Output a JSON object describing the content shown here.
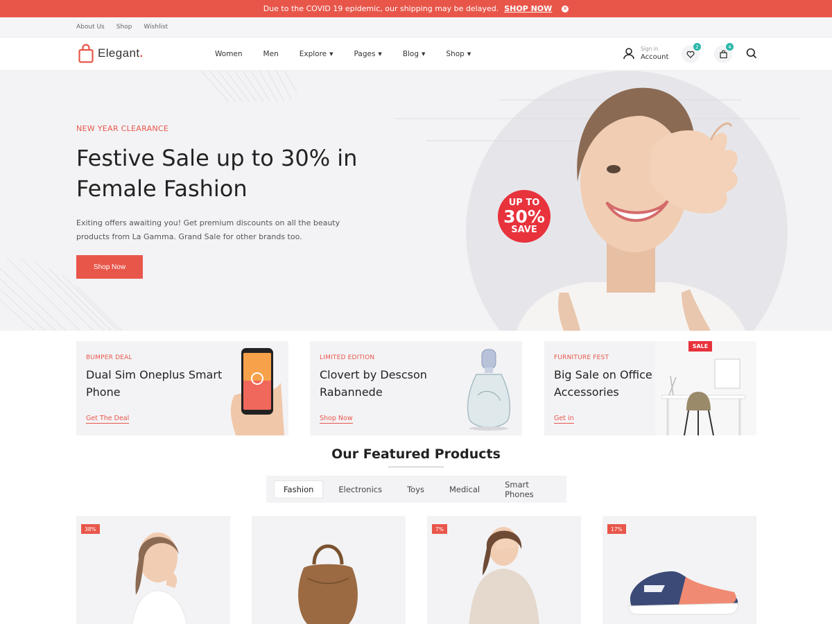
{
  "promo_bar": {
    "text": "Due to the COVID 19 epidemic, our shipping may be delayed.",
    "link": "SHOP NOW",
    "close_icon": "close-icon"
  },
  "util_nav": [
    "About Us",
    "Shop",
    "Wishlist"
  ],
  "header": {
    "logo": "Elegant",
    "logo_dot": ".",
    "nav": [
      {
        "label": "Women",
        "dropdown": false
      },
      {
        "label": "Men",
        "dropdown": false
      },
      {
        "label": "Explore",
        "dropdown": true
      },
      {
        "label": "Pages",
        "dropdown": true
      },
      {
        "label": "Blog",
        "dropdown": true
      },
      {
        "label": "Shop",
        "dropdown": true
      }
    ],
    "account_small": "Sign in",
    "account_big": "Account",
    "wishlist_count": "2",
    "cart_count": "4"
  },
  "hero": {
    "subtitle": "NEW YEAR CLEARANCE",
    "title": "Festive Sale up to 30% in Female Fashion",
    "description": "Exiting offers awaiting you! Get premium discounts on all the beauty products from La Gamma. Grand Sale for other brands too.",
    "button": "Shop Now",
    "badge": {
      "line1": "UP TO",
      "line2": "30%",
      "line3": "SAVE"
    }
  },
  "cards": [
    {
      "tag": "BUMPER DEAL",
      "title": "Dual Sim Oneplus Smart Phone",
      "link": "Get The Deal"
    },
    {
      "tag": "LIMITED EDITION",
      "title": "Clovert by Descson Rabannede",
      "link": "Shop Now"
    },
    {
      "tag": "FURNITURE FEST",
      "title": "Big Sale on Office Accessories",
      "link": "Get in",
      "flag": "SALE"
    }
  ],
  "featured": {
    "title": "Our Featured Products",
    "tabs": [
      "Fashion",
      "Electronics",
      "Toys",
      "Medical",
      "Smart Phones"
    ],
    "active_tab": "Fashion"
  },
  "products": [
    {
      "discount": "38%"
    },
    {
      "discount": ""
    },
    {
      "discount": "7%"
    },
    {
      "discount": "17%"
    }
  ],
  "colors": {
    "accent": "#e8564a",
    "sale_red": "#e8323c",
    "badge_teal": "#2ab7a9",
    "panel_bg": "#f3f3f5"
  }
}
